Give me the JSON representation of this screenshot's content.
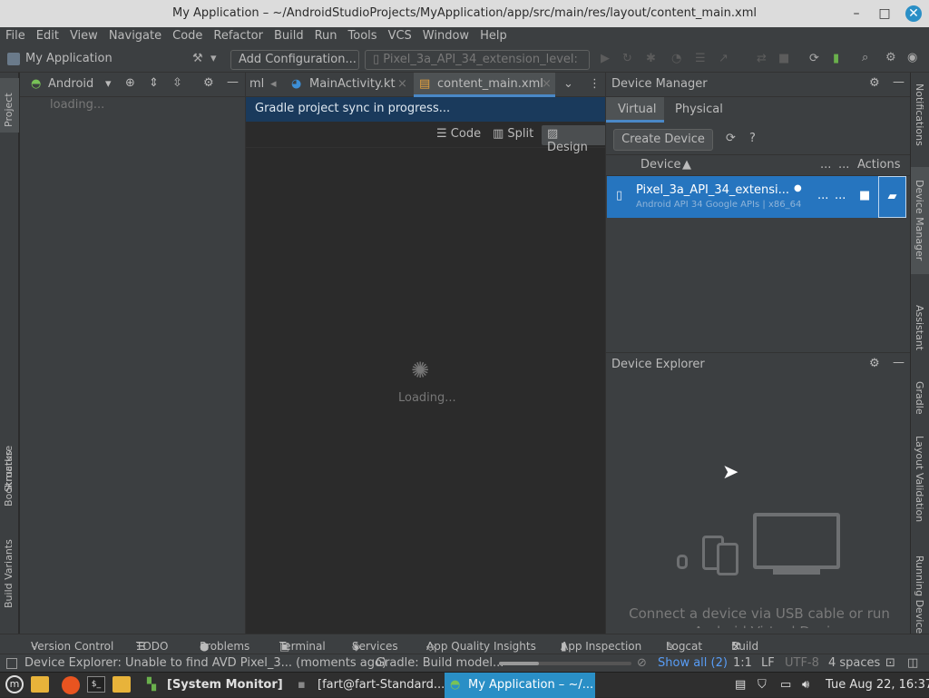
{
  "window": {
    "title": "My Application – ~/AndroidStudioProjects/MyApplication/app/src/main/res/layout/content_main.xml"
  },
  "menu": [
    "File",
    "Edit",
    "View",
    "Navigate",
    "Code",
    "Refactor",
    "Build",
    "Run",
    "Tools",
    "VCS",
    "Window",
    "Help"
  ],
  "toolbar": {
    "project_name": "My Application",
    "add_configuration": "Add Configuration...",
    "device_select": "Pixel_3a_API_34_extension_level:"
  },
  "left_strip": {
    "project": "Project",
    "structure": "Structure",
    "bookmarks": "Bookmarks",
    "build_variants": "Build Variants"
  },
  "project_panel": {
    "view_mode": "Android",
    "loading": "loading..."
  },
  "editor": {
    "tabs": [
      "ml",
      "MainActivity.kt",
      "content_main.xml"
    ],
    "banner": "Gradle project sync in progress...",
    "modes": [
      "Code",
      "Split",
      "Design"
    ],
    "loading": "Loading..."
  },
  "device_manager": {
    "title": "Device Manager",
    "tabs": [
      "Virtual",
      "Physical"
    ],
    "create_device": "Create Device",
    "columns": {
      "device": "Device",
      "dots1": "...",
      "dots2": "...",
      "actions": "Actions"
    },
    "row": {
      "name": "Pixel_3a_API_34_extensi...",
      "sub": "Android API 34 Google APIs | x86_64",
      "dots1": "...",
      "dots2": "..."
    }
  },
  "device_explorer": {
    "title": "Device Explorer",
    "message": "Connect a device via USB cable or run an Android Virtual Device"
  },
  "right_strip": {
    "notifications": "Notifications",
    "device_manager": "Device Manager",
    "assistant": "Assistant",
    "gradle": "Gradle",
    "layout_validation": "Layout Validation",
    "running_devices": "Running Devices"
  },
  "bottom_tools": [
    "Version Control",
    "TODO",
    "Problems",
    "Terminal",
    "Services",
    "App Quality Insights",
    "App Inspection",
    "Logcat",
    "Build"
  ],
  "status": {
    "message": "Device Explorer: Unable to find AVD Pixel_3... (moments ago)",
    "gradle": "Gradle: Build model...",
    "show_all": "Show all (2)",
    "position": "1:1",
    "line_sep": "LF",
    "encoding": "UTF-8",
    "indent": "4 spaces"
  },
  "taskbar": {
    "system_monitor": "[System Monitor]",
    "terminal": "[fart@fart-Standard...",
    "studio": "My Application – ~/...",
    "clock": "Tue Aug 22, 16:37"
  },
  "colors": {
    "accent": "#2675bf",
    "panel": "#3c3f41",
    "editor": "#2b2b2b"
  }
}
